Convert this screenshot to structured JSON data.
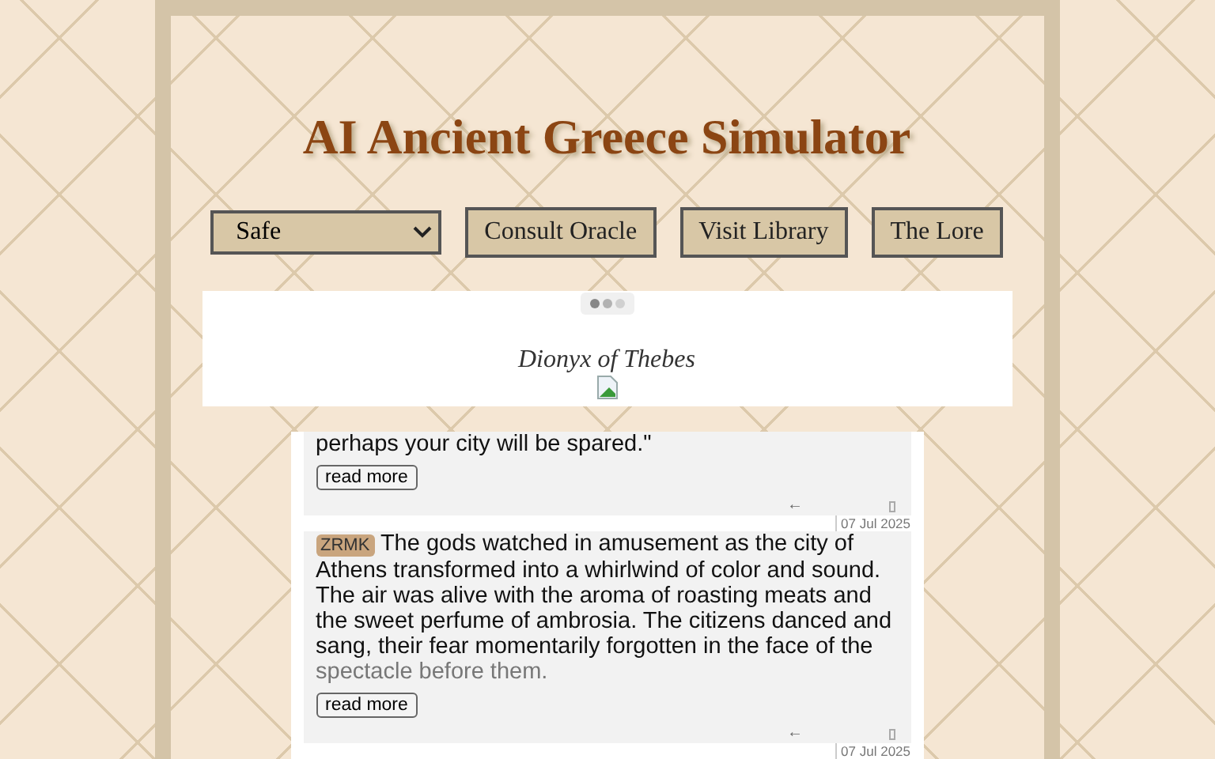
{
  "title": "AI Ancient Greece Simulator",
  "controls": {
    "select": {
      "value": "Safe"
    },
    "buttons": [
      "Consult Oracle",
      "Visit Library",
      "The Lore"
    ]
  },
  "header": {
    "name": "Dionyx of Thebes"
  },
  "posts": [
    {
      "text": "perhaps your city will be spared.\"",
      "button": "read more",
      "reply": "←"
    },
    {
      "date": "07 Jul 2025",
      "badge": "ZRMK",
      "text": "The gods watched in amusement as the city of Athens transformed into a whirlwind of color and sound. The air was alive with the aroma of roasting meats and the sweet perfume of ambrosia. The citizens danced and sang, their fear momentarily forgotten in the face of the",
      "faded": "spectacle before them.",
      "button": "read more",
      "reply": "←"
    },
    {
      "date": "07 Jul 2025"
    }
  ]
}
